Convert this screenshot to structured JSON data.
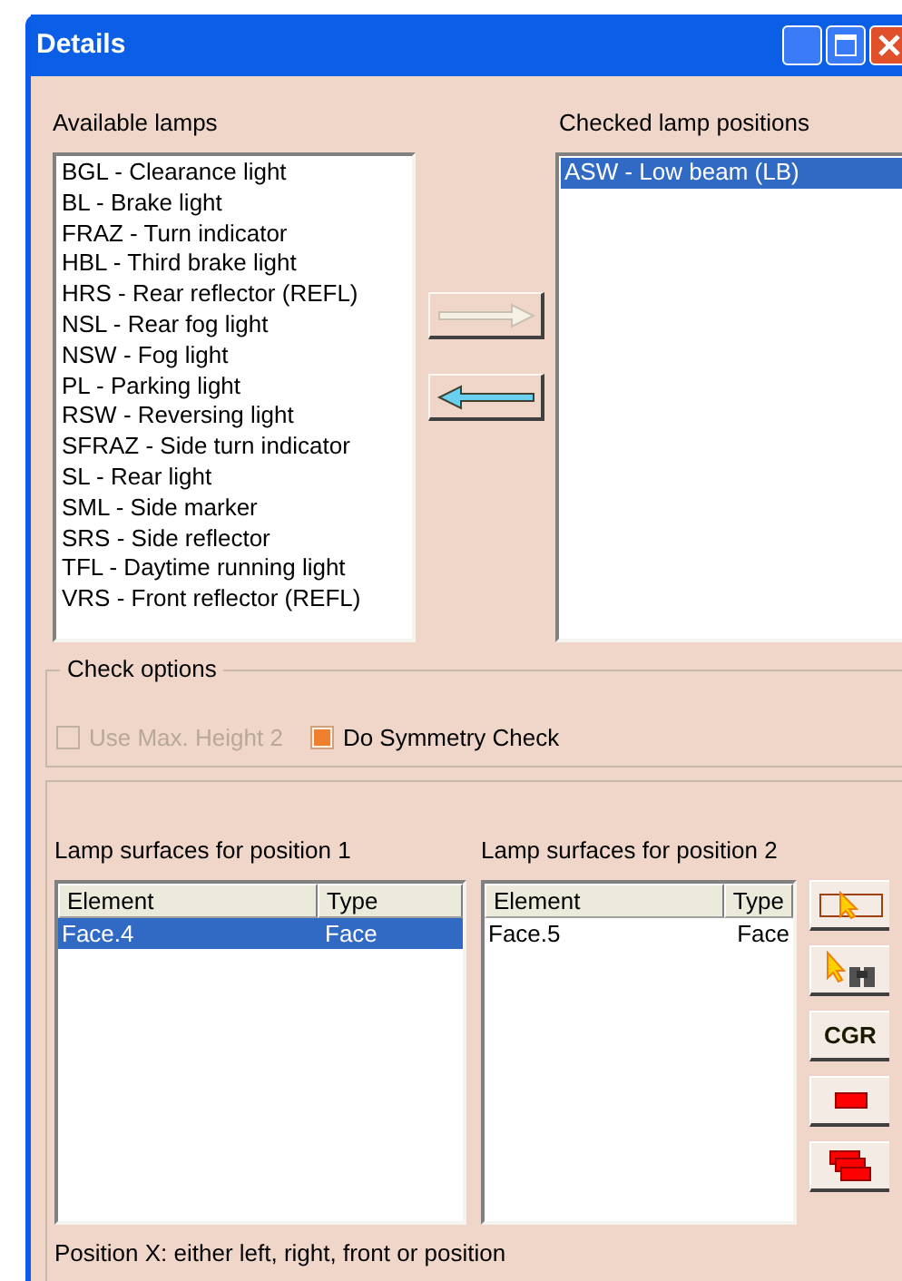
{
  "window": {
    "title": "Details"
  },
  "available_lamps": {
    "label": "Available lamps",
    "items": [
      {
        "text": "BGL - Clearance light",
        "selected": false
      },
      {
        "text": "BL - Brake light",
        "selected": false
      },
      {
        "text": "FRAZ - Turn indicator",
        "selected": false
      },
      {
        "text": "HBL - Third brake light",
        "selected": false
      },
      {
        "text": "HRS - Rear reflector (REFL)",
        "selected": false
      },
      {
        "text": "NSL - Rear fog light",
        "selected": false
      },
      {
        "text": "NSW - Fog light",
        "selected": false
      },
      {
        "text": "PL - Parking light",
        "selected": false
      },
      {
        "text": "RSW - Reversing light",
        "selected": false
      },
      {
        "text": "SFRAZ - Side turn indicator",
        "selected": false
      },
      {
        "text": "SL - Rear light",
        "selected": false
      },
      {
        "text": "SML - Side marker",
        "selected": false
      },
      {
        "text": "SRS - Side reflector",
        "selected": false
      },
      {
        "text": "TFL - Daytime running light",
        "selected": false
      },
      {
        "text": "VRS - Front reflector (REFL)",
        "selected": false
      }
    ]
  },
  "transfer_buttons": [
    {
      "kind": "right",
      "disabled": true
    },
    {
      "kind": "left",
      "disabled": false
    }
  ],
  "checked_positions": {
    "label": "Checked lamp positions",
    "items": [
      {
        "text": "ASW - Low beam (LB)",
        "selected": true
      }
    ]
  },
  "check_options": {
    "label": "Check options",
    "options": [
      {
        "label": "Use Max. Height 2",
        "checked": false,
        "disabled": true
      },
      {
        "label": "Do Symmetry Check",
        "checked": true,
        "disabled": false
      }
    ]
  },
  "surface_tables": [
    {
      "label": "Lamp surfaces for position 1",
      "columns": [
        "Element",
        "Type"
      ],
      "rows": [
        {
          "cells": [
            "Face.4",
            "Face"
          ],
          "selected": true
        }
      ]
    },
    {
      "label": "Lamp surfaces for position 2",
      "columns": [
        "Element",
        "Type"
      ],
      "rows": [
        {
          "cells": [
            "Face.5",
            "Face"
          ],
          "selected": false
        }
      ]
    }
  ],
  "side_buttons": [
    {
      "kind": "select"
    },
    {
      "kind": "search"
    },
    {
      "kind": "text",
      "label": "CGR"
    },
    {
      "kind": "remove"
    },
    {
      "kind": "remove_all"
    }
  ],
  "status_text": "Position X: either left, right, front or position"
}
